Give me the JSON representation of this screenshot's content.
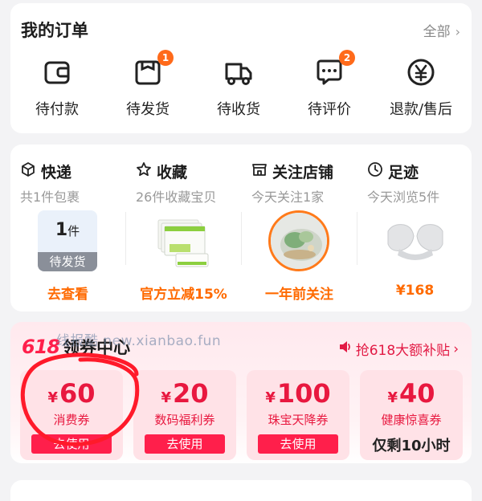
{
  "orders": {
    "title": "我的订单",
    "all_label": "全部",
    "items": [
      {
        "label": "待付款",
        "icon": "wallet-icon"
      },
      {
        "label": "待发货",
        "icon": "box-icon",
        "badge": "1"
      },
      {
        "label": "待收货",
        "icon": "truck-icon"
      },
      {
        "label": "待评价",
        "icon": "comment-icon",
        "badge": "2"
      },
      {
        "label": "退款/售后",
        "icon": "yen-circle-icon"
      }
    ]
  },
  "tracking": {
    "columns": [
      {
        "title": "快递",
        "icon": "cube-icon",
        "subtitle": "共1件包裹",
        "package_count": "1",
        "package_unit": "件",
        "package_status": "待发货",
        "footer": "去查看"
      },
      {
        "title": "收藏",
        "icon": "star-icon",
        "subtitle": "26件收藏宝贝",
        "footer": "官方立减15%"
      },
      {
        "title": "关注店铺",
        "icon": "store-icon",
        "subtitle": "今天关注1家",
        "footer": "一年前关注"
      },
      {
        "title": "足迹",
        "icon": "clock-icon",
        "subtitle": "今天浏览5件",
        "footer": "¥168"
      }
    ]
  },
  "coupons": {
    "title_prefix": "618",
    "title": "领券中心",
    "grab_label": "抢618大额补贴",
    "items": [
      {
        "currency": "¥",
        "amount": "60",
        "name": "消费券",
        "action": "去使用"
      },
      {
        "currency": "¥",
        "amount": "20",
        "name": "数码福利券",
        "action": "去使用"
      },
      {
        "currency": "¥",
        "amount": "100",
        "name": "珠宝天降券",
        "action": "去使用"
      },
      {
        "currency": "¥",
        "amount": "40",
        "name": "健康惊喜券",
        "remaining": "仅剩10小时"
      }
    ]
  },
  "watermark": "线报酷 new.xianbao.fun",
  "colors": {
    "accent": "#ff6a00",
    "coupon_red": "#e8183f",
    "button_red": "#ff1f4b",
    "badge": "#ff6a1a"
  }
}
